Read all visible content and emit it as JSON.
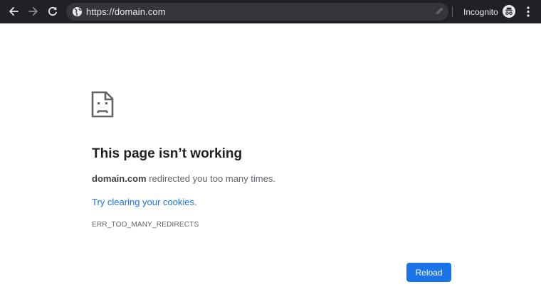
{
  "browser": {
    "url": "https://domain.com",
    "incognito_label": "Incognito",
    "icons": {
      "back": "arrow-back-icon",
      "forward": "arrow-forward-icon",
      "reload": "reload-icon",
      "site_info": "globe-icon",
      "pen": "pen-icon",
      "incognito": "incognito-icon",
      "menu": "kebab-menu-icon"
    },
    "colors": {
      "toolbar": "#202124",
      "omnibox": "#35363a",
      "text": "#e8eaed"
    }
  },
  "error": {
    "icon": "sad-page-icon",
    "title": "This page isn’t working",
    "domain": "domain.com",
    "message": " redirected you too many times.",
    "suggestion": "Try clearing your cookies.",
    "code": "ERR_TOO_MANY_REDIRECTS",
    "reload_label": "Reload",
    "colors": {
      "accent": "#1a73e8",
      "title": "#202124",
      "body": "#5f6368"
    }
  }
}
